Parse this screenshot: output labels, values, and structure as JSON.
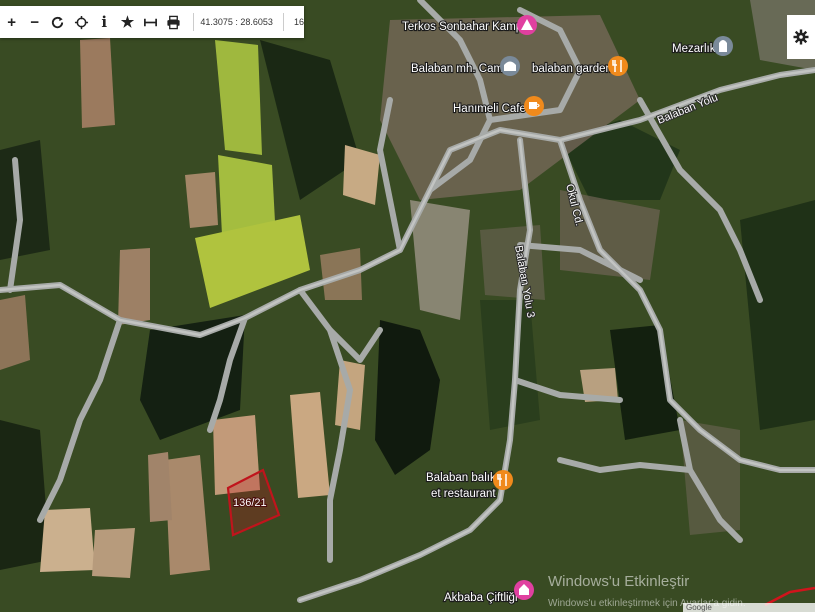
{
  "toolbar": {
    "coordinates": "41.3075 : 28.6053",
    "zoom": "16",
    "buttons": [
      "zoom-in",
      "zoom-out",
      "refresh",
      "locate",
      "info",
      "favorite",
      "measure",
      "print"
    ]
  },
  "pois": [
    {
      "label": "Terkos Sonbahar Kampı",
      "icon": "camping-icon",
      "color": "#e040a0"
    },
    {
      "label": "Balaban mh. Cami",
      "icon": "mosque-icon",
      "color": "#7a8a9a"
    },
    {
      "label": "balaban garden",
      "icon": "restaurant-icon",
      "color": "#f08a1c"
    },
    {
      "label": "Hanımeli Cafe",
      "icon": "cafe-icon",
      "color": "#f08a1c"
    },
    {
      "label": "Mezarlık",
      "icon": "cemetery-icon",
      "color": "#7a8a9a"
    },
    {
      "label": "Balaban balık",
      "label2": "et restaurant",
      "icon": "restaurant-icon",
      "color": "#f08a1c"
    },
    {
      "label": "Akbaba Çiftliği",
      "icon": "farm-icon",
      "color": "#e040a0"
    }
  ],
  "roads": {
    "balaban_yolu": "Balaban Yolu",
    "okul_cd": "Okul Cd.",
    "balaban_yolu_3": "Balaban Yolu 3"
  },
  "parcel": {
    "label": "136/21",
    "color": "#c0141c"
  },
  "watermark": {
    "line1": "Windows'u Etkinleştir",
    "line2": "Windows'u etkinleştirmek için Ayarlar'a gidin."
  },
  "attribution": "Google"
}
